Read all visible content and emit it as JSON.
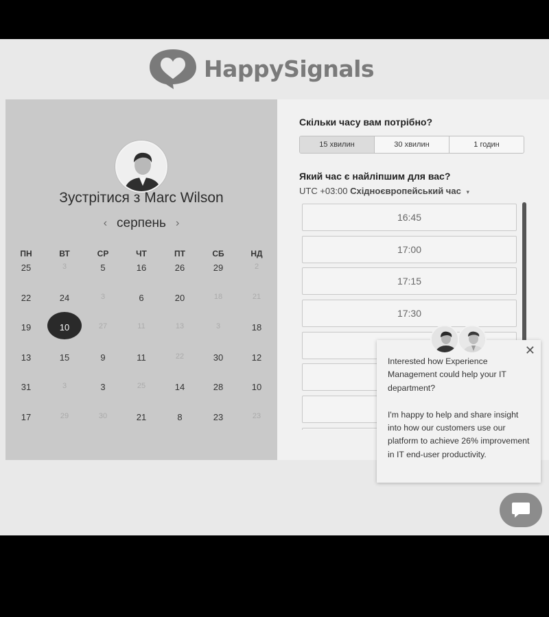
{
  "brand": {
    "name": "HappySignals",
    "logo_color": "#7a7a7a"
  },
  "host": {
    "meet_title": "Зустрітися з Marc Wilson",
    "month": "серпень",
    "prev_icon": "chevron-left-icon",
    "next_icon": "chevron-right-icon"
  },
  "calendar": {
    "weekdays": [
      "ПН",
      "ВТ",
      "СР",
      "ЧТ",
      "ПТ",
      "СБ",
      "НД"
    ],
    "weeks": [
      [
        {
          "d": "25",
          "dim": false
        },
        {
          "d": "3",
          "dim": true
        },
        {
          "d": "5",
          "dim": false
        },
        {
          "d": "16",
          "dim": false
        },
        {
          "d": "26",
          "dim": false
        },
        {
          "d": "29",
          "dim": false
        },
        {
          "d": "2",
          "dim": true
        }
      ],
      [
        {
          "d": "22",
          "dim": false
        },
        {
          "d": "24",
          "dim": false
        },
        {
          "d": "3",
          "dim": true
        },
        {
          "d": "6",
          "dim": false
        },
        {
          "d": "20",
          "dim": false
        },
        {
          "d": "18",
          "dim": true
        },
        {
          "d": "21",
          "dim": true
        }
      ],
      [
        {
          "d": "19",
          "dim": false
        },
        {
          "d": "10",
          "dim": false,
          "selected": true
        },
        {
          "d": "27",
          "dim": true
        },
        {
          "d": "11",
          "dim": true
        },
        {
          "d": "13",
          "dim": true
        },
        {
          "d": "3",
          "dim": true
        },
        {
          "d": "18",
          "dim": false
        }
      ],
      [
        {
          "d": "13",
          "dim": false
        },
        {
          "d": "15",
          "dim": false
        },
        {
          "d": "9",
          "dim": false
        },
        {
          "d": "11",
          "dim": false
        },
        {
          "d": "22",
          "dim": true
        },
        {
          "d": "30",
          "dim": false
        },
        {
          "d": "12",
          "dim": false
        }
      ],
      [
        {
          "d": "31",
          "dim": false
        },
        {
          "d": "3",
          "dim": true
        },
        {
          "d": "3",
          "dim": false
        },
        {
          "d": "25",
          "dim": true
        },
        {
          "d": "14",
          "dim": false
        },
        {
          "d": "28",
          "dim": false
        },
        {
          "d": "10",
          "dim": false
        }
      ],
      [
        {
          "d": "17",
          "dim": false
        },
        {
          "d": "29",
          "dim": true
        },
        {
          "d": "30",
          "dim": true
        },
        {
          "d": "21",
          "dim": false
        },
        {
          "d": "8",
          "dim": false
        },
        {
          "d": "23",
          "dim": false
        },
        {
          "d": "23",
          "dim": true
        }
      ]
    ]
  },
  "duration": {
    "question": "Скільки часу вам потрібно?",
    "options": [
      "15 хвилин",
      "30 хвилин",
      "1 годин"
    ],
    "selected": "15 хвилин"
  },
  "time": {
    "question": "Який час є найліпшим для вас?",
    "tz_prefix": "UTC +03:00 ",
    "tz_name": "Східноєвропейський час",
    "slots": [
      "16:45",
      "17:00",
      "17:15",
      "17:30",
      "",
      "",
      "",
      ""
    ]
  },
  "chat": {
    "close_icon": "close-icon",
    "paragraph1": "Interested how Experience Management could help your IT department?",
    "paragraph2": "I'm happy to help and share insight into how our customers use our platform to achieve 26% improvement in IT end-user productivity.",
    "launcher_icon": "chat-bubble-icon"
  }
}
